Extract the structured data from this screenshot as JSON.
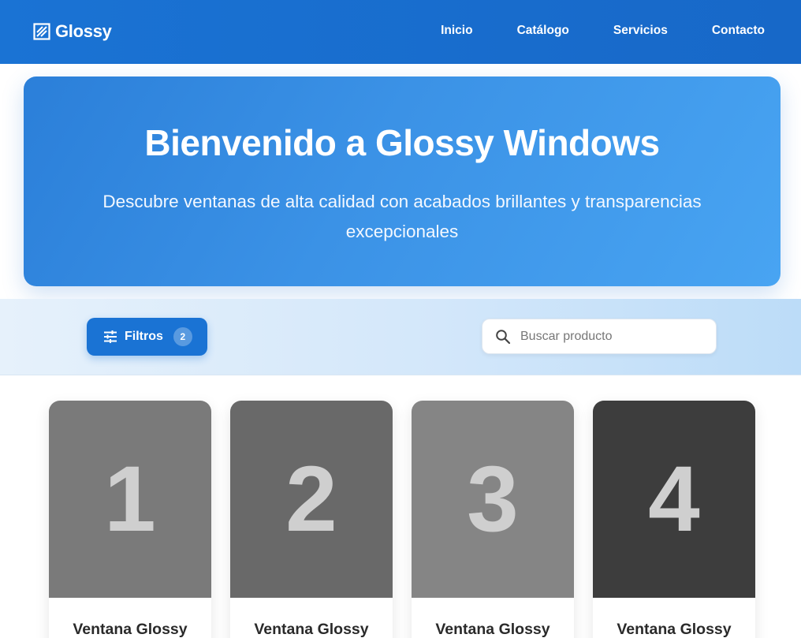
{
  "brand": {
    "name": "Glossy",
    "logo_icon": "window-pane-icon",
    "primary_color": "#1a73d4"
  },
  "nav": {
    "links": [
      {
        "label": "Inicio"
      },
      {
        "label": "Catálogo"
      },
      {
        "label": "Servicios"
      },
      {
        "label": "Contacto"
      }
    ]
  },
  "hero": {
    "title": "Bienvenido a Glossy Windows",
    "subtitle": "Descubre ventanas de alta calidad con acabados brillantes y transparencias excepcionales"
  },
  "filters": {
    "button_label": "Filtros",
    "button_icon": "tune-icon",
    "active_count": "2"
  },
  "search": {
    "placeholder": "Buscar producto",
    "value": "",
    "icon": "search-icon"
  },
  "products": [
    {
      "number": "1",
      "title": "Ventana Glossy",
      "image_color": "#7a7a7a"
    },
    {
      "number": "2",
      "title": "Ventana Glossy",
      "image_color": "#696969"
    },
    {
      "number": "3",
      "title": "Ventana Glossy",
      "image_color": "#858585"
    },
    {
      "number": "4",
      "title": "Ventana Glossy",
      "image_color": "#3d3d3d"
    }
  ]
}
